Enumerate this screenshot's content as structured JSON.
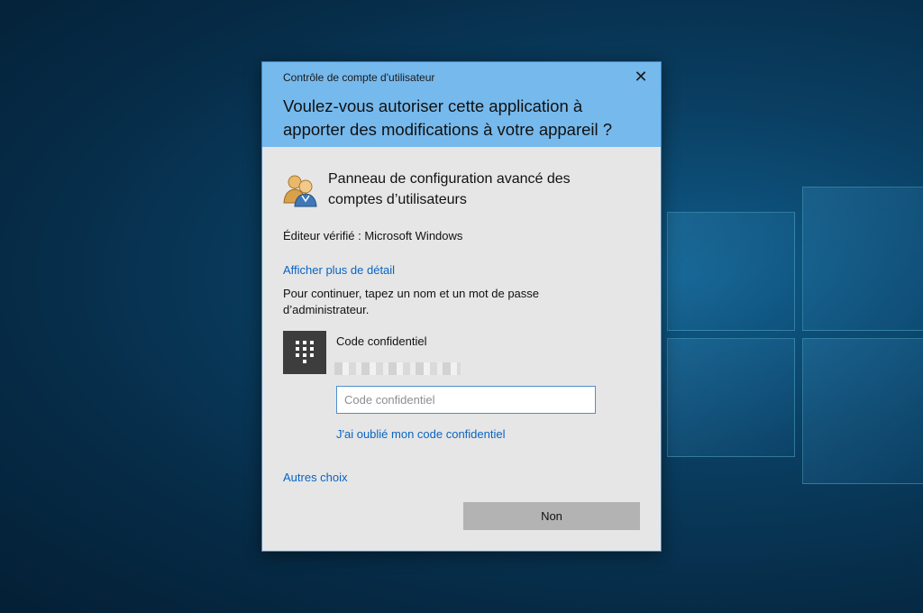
{
  "dialog": {
    "caption": "Contrôle de compte d'utilisateur",
    "close_glyph": "✕",
    "question": "Voulez-vous autoriser cette application à apporter des modifications à votre appareil ?",
    "app_name": "Panneau de configuration avancé des comptes d’utilisateurs",
    "app_icon": "users-icon",
    "publisher": "Éditeur vérifié : Microsoft Windows",
    "details_link": "Afficher plus de détail",
    "instruction": "Pour continuer, tapez un nom et un mot de passe d’administrateur.",
    "credential": {
      "tile_icon": "keypad-icon",
      "label": "Code confidentiel",
      "input_placeholder": "Code confidentiel",
      "input_value": "",
      "forgot_link": "J'ai oublié mon code confidentiel"
    },
    "other_choices_link": "Autres choix",
    "no_button": "Non"
  },
  "colors": {
    "header": "#76b9ed",
    "body": "#e6e6e6",
    "link": "#0a64c2",
    "button": "#b3b3b3",
    "tile": "#3d3d3d"
  }
}
